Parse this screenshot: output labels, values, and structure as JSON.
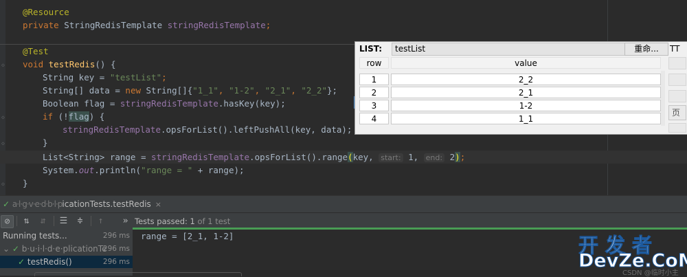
{
  "editor": {
    "lines": {
      "l1_ann": "@Resource",
      "l2_kw": "private",
      "l2_type": " StringRedisTemplate ",
      "l2_field": "stringRedisTemplate",
      "l2_end": ";",
      "l3_ann": "@Test",
      "l4_kw": "void",
      "l4_fn": "testRedis",
      "l4_end": "() {",
      "l5_a": "String key = ",
      "l5_str": "\"testList\"",
      "l5_end": ";",
      "l6_a": "String[] data = ",
      "l6_kw": "new",
      "l6_b": " String[]{",
      "l6_s1": "\"1_1\"",
      "l6_c1": ", ",
      "l6_s2": "\"1-2\"",
      "l6_c2": ", ",
      "l6_s3": "\"2_1\"",
      "l6_c3": ", ",
      "l6_s4": "\"2_2\"",
      "l6_end": "};",
      "l7_a": "Boolean flag = ",
      "l7_field": "stringRedisTemplate",
      "l7_end": ".hasKey(key);",
      "l8_kw": "if",
      "l8_a": " (!",
      "l8_hl": "flag",
      "l8_end": ") {",
      "l9_field": "stringRedisTemplate",
      "l9_end": ".opsForList().leftPushAll(key, data);",
      "l10": "}",
      "l11_a": "List<String> range = ",
      "l11_field": "stringRedisTemplate",
      "l11_b": ".opsForList().range",
      "l11_paren": "(",
      "l11_c": "key, ",
      "l11_hint1": "start:",
      "l11_d": " 1, ",
      "l11_hint2": "end:",
      "l11_e": " 2",
      "l11_paren2": ")",
      "l11_end": ";",
      "l12_a": "System.",
      "l12_out": "out",
      "l12_b": ".println(",
      "l12_str": "\"range = \"",
      "l12_end": " + range);",
      "l13": "}"
    }
  },
  "redis_popup": {
    "label": "LIST:",
    "key_value": "testList",
    "rename_button": "重命...",
    "ttl_label": "TT",
    "side_button": "页",
    "columns": [
      "row",
      "value"
    ],
    "rows": [
      {
        "row": "1",
        "value": "2_2"
      },
      {
        "row": "2",
        "value": "2_1"
      },
      {
        "row": "3",
        "value": "1-2"
      },
      {
        "row": "4",
        "value": "1_1"
      }
    ]
  },
  "run": {
    "tab_prefix": "a·l·g·v·e·d·b·l·p",
    "tab_suffix": "icationTests.testRedis",
    "close": "×",
    "tests_passed_label": "Tests passed: ",
    "tests_passed_count": "1",
    "tests_passed_total": " of 1 test",
    "tree": [
      {
        "label": "Running tests...",
        "duration": "296 ms"
      },
      {
        "label": "b·u·i·l·d·e·plicationTe",
        "duration": "296 ms"
      },
      {
        "label": "testRedis()",
        "duration": "296 ms"
      }
    ],
    "console_output": "range = [2_1, 1-2]"
  },
  "watermark": {
    "cn": "开发者",
    "en": "DevZe.CoM",
    "small": "CSDN @临时小主"
  }
}
